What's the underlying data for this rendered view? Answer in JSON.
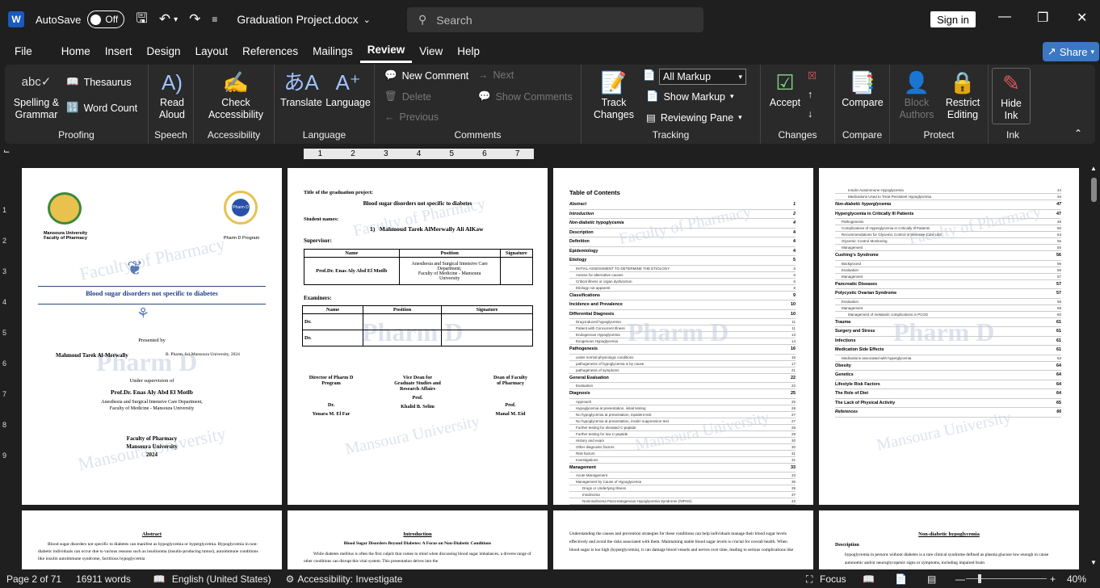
{
  "titlebar": {
    "logo": "W",
    "autosave_label": "AutoSave",
    "autosave_state": "Off",
    "document_name": "Graduation Project.docx",
    "search_placeholder": "Search",
    "signin_label": "Sign in"
  },
  "menu": {
    "items": [
      "File",
      "Home",
      "Insert",
      "Design",
      "Layout",
      "References",
      "Mailings",
      "Review",
      "View",
      "Help"
    ],
    "active": "Review",
    "share_label": "Share"
  },
  "ribbon": {
    "proofing": {
      "label": "Proofing",
      "spelling": "Spelling &",
      "spelling2": "Grammar",
      "thesaurus": "Thesaurus",
      "word_count": "Word Count"
    },
    "speech": {
      "label": "Speech",
      "read": "Read",
      "read2": "Aloud"
    },
    "accessibility": {
      "label": "Accessibility",
      "check": "Check",
      "check2": "Accessibility"
    },
    "language": {
      "label": "Language",
      "translate": "Translate",
      "language": "Language"
    },
    "comments": {
      "label": "Comments",
      "new": "New Comment",
      "delete": "Delete",
      "previous": "Previous",
      "next": "Next",
      "show": "Show Comments"
    },
    "tracking": {
      "label": "Tracking",
      "track": "Track",
      "track2": "Changes",
      "markup_select": "All Markup",
      "show_markup": "Show Markup",
      "reviewing_pane": "Reviewing Pane"
    },
    "changes": {
      "label": "Changes",
      "accept": "Accept"
    },
    "compare": {
      "label": "Compare",
      "compare": "Compare"
    },
    "protect": {
      "label": "Protect",
      "block": "Block",
      "block2": "Authors",
      "restrict": "Restrict",
      "restrict2": "Editing"
    },
    "ink": {
      "label": "Ink",
      "hide": "Hide",
      "hide2": "Ink"
    }
  },
  "ruler": {
    "ticks": [
      "1",
      "2",
      "3",
      "4",
      "5",
      "6",
      "7"
    ]
  },
  "vruler": {
    "ticks": [
      "1",
      "2",
      "3",
      "4",
      "5",
      "6",
      "7",
      "8",
      "9"
    ]
  },
  "page1": {
    "uni1": "Mansoura University",
    "uni2": "Faculty of Pharmacy",
    "program": "Pharm D Program",
    "badge": "Pharm D",
    "title": "Blood sugar disorders not specific to diabetes",
    "presented_by": "Presented by",
    "student": "Mahmoud Tarek Al-Merwally",
    "degree": "B. Pharm. Sci.Mansoura University, 2024",
    "supervision": "Under supervision of",
    "prof": "Prof.Dr. Enas Aly Abd El Motlb",
    "dept1": "Anesthesia and Surgical Intensive Care Department,",
    "dept2": "Faculty of Medicine - Mansoura University",
    "foot1": "Faculty of Pharmacy",
    "foot2": "Mansoura University",
    "foot3": "2024",
    "wm1": "Faculty of Pharmacy",
    "wm2": "Pharm D",
    "wm3": "Mansoura University"
  },
  "page2": {
    "title_label": "Title of the graduation project:",
    "title": "Blood sugar disorders not specific to diabetes",
    "student_names": "Student names:",
    "student": "Mahmoud Tarek AlMerwally Ali AlKaw",
    "student_num": "1)",
    "supervisor": "Supervisor:",
    "headers": [
      "Name",
      "Position",
      "Signature"
    ],
    "sup_name": "Prof.Dr. Enas Aly Abd El Motlb",
    "sup_pos1": "Anesthesia and Surgical Intensive Care",
    "sup_pos2": "Department,",
    "sup_pos3": "Faculty of Medicine - Mansoura",
    "sup_pos4": "University",
    "examiners": "Examiners:",
    "dr": "Dr.",
    "dir1": "Director of Pharm D",
    "dir2": "Program",
    "dir3": "Dr.",
    "dir4": "Youara M. El Far",
    "vice1": "Vice Dean for",
    "vice2": "Graduate Studies and",
    "vice3": "Research Affairs",
    "vice4": "Prof.",
    "vice5": "Khalid B. Selim",
    "dean1": "Dean of Faculty",
    "dean2": "of Pharmacy",
    "dean3": "Prof.",
    "dean4": "Manal M. Eid"
  },
  "page3": {
    "heading": "Table of Contents",
    "entries": [
      {
        "t": "Abstract",
        "p": "1",
        "c": "i"
      },
      {
        "t": "Introduction",
        "p": "2",
        "c": "i"
      },
      {
        "t": "Non-diabetic hypoglycemia",
        "p": "4",
        "c": "i"
      },
      {
        "t": "Description",
        "p": "4",
        "c": "h"
      },
      {
        "t": "Definition",
        "p": "4",
        "c": "h"
      },
      {
        "t": "Epidemiology",
        "p": "4",
        "c": "h"
      },
      {
        "t": "Etiology",
        "p": "5",
        "c": "h"
      },
      {
        "t": "INITIAL ASSESSMENT TO DETERMINE THE ETIOLOGY",
        "p": "6",
        "c": "s"
      },
      {
        "t": "Assess for alternative causes",
        "p": "6",
        "c": "s"
      },
      {
        "t": "Critical illness or organ dysfunction",
        "p": "6",
        "c": "s"
      },
      {
        "t": "Etiology not apparent",
        "p": "8",
        "c": "s"
      },
      {
        "t": "Classifications",
        "p": "9",
        "c": "h"
      },
      {
        "t": "Incidence and Prevalence",
        "p": "10",
        "c": "h"
      },
      {
        "t": "Differential Diagnosis",
        "p": "10",
        "c": "h"
      },
      {
        "t": "Drug-induced hypoglycemia",
        "p": "11",
        "c": "s"
      },
      {
        "t": "Patient with Concurrent Illness",
        "p": "11",
        "c": "s"
      },
      {
        "t": "Endogenous Hypoglycemia",
        "p": "13",
        "c": "s"
      },
      {
        "t": "Exogenous Hypoglycemia",
        "p": "14",
        "c": "s"
      },
      {
        "t": "Pathogenesis",
        "p": "16",
        "c": "h"
      },
      {
        "t": "under normal physiologic conditions",
        "p": "16",
        "c": "s"
      },
      {
        "t": "pathogenesis of hypoglycemia is by cause",
        "p": "17",
        "c": "s"
      },
      {
        "t": "pathogenesis of symptoms",
        "p": "21",
        "c": "s"
      },
      {
        "t": "General Evaluation",
        "p": "22",
        "c": "h"
      },
      {
        "t": "Evaluation",
        "p": "22",
        "c": "s"
      },
      {
        "t": "Diagnosis",
        "p": "25",
        "c": "h"
      },
      {
        "t": "Approach",
        "p": "25",
        "c": "s"
      },
      {
        "t": "Hypoglycemia at presentation, initial testing",
        "p": "26",
        "c": "s"
      },
      {
        "t": "No hypoglycemia at presentation, inpatient test",
        "p": "27",
        "c": "s"
      },
      {
        "t": "No hypoglycemia at presentation, insulin suppression test",
        "p": "27",
        "c": "s"
      },
      {
        "t": "Further testing for elevated C-peptide",
        "p": "28",
        "c": "s"
      },
      {
        "t": "Further testing for low C-peptide",
        "p": "29",
        "c": "s"
      },
      {
        "t": "History and exam",
        "p": "30",
        "c": "s"
      },
      {
        "t": "Other diagnostic factors",
        "p": "30",
        "c": "s"
      },
      {
        "t": "Risk factors",
        "p": "31",
        "c": "s"
      },
      {
        "t": "Investigations",
        "p": "31",
        "c": "s"
      },
      {
        "t": "Management",
        "p": "33",
        "c": "h"
      },
      {
        "t": "Acute Management",
        "p": "33",
        "c": "s"
      },
      {
        "t": "Management by Cause of Hypoglycemia",
        "p": "35",
        "c": "s"
      },
      {
        "t": "Drugs or Underlying Illness",
        "p": "35",
        "c": "ss"
      },
      {
        "t": "Insulinoma",
        "p": "37",
        "c": "ss"
      },
      {
        "t": "Noninsulinoma Pancreatogenous Hypoglycemia Syndrome (NIPHS)",
        "p": "42",
        "c": "ss"
      },
      {
        "t": "Post-gastric Bypass Hypoglycemia",
        "p": "43",
        "c": "ss"
      }
    ]
  },
  "page4": {
    "entries": [
      {
        "t": "Insulin Autoimmune Hypoglycemia",
        "p": "44",
        "c": "ss"
      },
      {
        "t": "Medications Used to Treat Persistent Hypoglycemia",
        "p": "46",
        "c": "ss"
      },
      {
        "t": "Non-diabetic hyperglycemia",
        "p": "47",
        "c": "i"
      },
      {
        "t": "Hyperglycemia in Critically Ill Patients",
        "p": "47",
        "c": "h"
      },
      {
        "t": "Pathogenesis",
        "p": "48",
        "c": "s"
      },
      {
        "t": "Complications of Hyperglycemia in Critically Ill Patients",
        "p": "50",
        "c": "s"
      },
      {
        "t": "Recommendations for Glycemic Control in Intensive Care Unit",
        "p": "53",
        "c": "s"
      },
      {
        "t": "Glycemic Control Monitoring",
        "p": "55",
        "c": "s"
      },
      {
        "t": "Management",
        "p": "55",
        "c": "s"
      },
      {
        "t": "Cushing's Syndrome",
        "p": "56",
        "c": "h"
      },
      {
        "t": "Background",
        "p": "56",
        "c": "s"
      },
      {
        "t": "Evaluation",
        "p": "56",
        "c": "s"
      },
      {
        "t": "Management",
        "p": "57",
        "c": "s"
      },
      {
        "t": "Pancreatic Diseases",
        "p": "57",
        "c": "h"
      },
      {
        "t": "Polycystic Ovarian Syndrome",
        "p": "57",
        "c": "h"
      },
      {
        "t": "Evaluation",
        "p": "58",
        "c": "s"
      },
      {
        "t": "Management",
        "p": "59",
        "c": "s"
      },
      {
        "t": "Management of metabolic complications in PCOS",
        "p": "60",
        "c": "ss"
      },
      {
        "t": "Trauma",
        "p": "61",
        "c": "h"
      },
      {
        "t": "Surgery and Stress",
        "p": "61",
        "c": "h"
      },
      {
        "t": "Infections",
        "p": "61",
        "c": "h"
      },
      {
        "t": "Medication Side Effects",
        "p": "61",
        "c": "h"
      },
      {
        "t": "Medications associated with hyperglycemia",
        "p": "63",
        "c": "s"
      },
      {
        "t": "Obesity",
        "p": "64",
        "c": "h"
      },
      {
        "t": "Genetics",
        "p": "64",
        "c": "h"
      },
      {
        "t": "Lifestyle Risk Factors",
        "p": "64",
        "c": "h"
      },
      {
        "t": "The Role of Diet",
        "p": "64",
        "c": "h"
      },
      {
        "t": "The Lack of Physical Activity",
        "p": "65",
        "c": "h"
      },
      {
        "t": "References",
        "p": "66",
        "c": "i"
      }
    ]
  },
  "row2": {
    "abstract_title": "Abstract",
    "abstract_text": "Blood sugar disorders not specific to diabetes can manifest as hypoglycemia or hyperglycemia. Hypoglycemia in non-diabetic individuals can occur due to various reasons such as insulinoma (insulin-producing tumor), autoimmune conditions like insulin autoimmune syndrome, factitious hypoglycemia",
    "intro_title": "Introduction",
    "intro_sub": "Blood Sugar Disorders Beyond Diabetes: A Focus on Non-Diabetic Conditions",
    "intro_text": "While diabetes mellitus is often the first culprit that comes to mind when discussing blood sugar imbalances, a diverse range of other conditions can disrupt this vital system. This presentation delves into the",
    "p3_text": "Understanding the causes and prevention strategies for these conditions can help individuals manage their blood sugar levels effectively and avoid the risks associated with them. Maintaining stable blood sugar levels is crucial for overall health. When blood sugar is too high (hyperglycemia), it can damage blood vessels and nerves over time, leading to serious complications like",
    "p4_title": "Non-diabetic hypoglycemia",
    "p4_desc": "Description",
    "p4_text": "hypoglycemia in persons without diabetes is a rare clinical syndrome defined as plasma glucose low enough to cause autonomic and/or neuroglycopenic signs or symptoms, including impaired brain"
  },
  "status": {
    "page": "Page 2 of 71",
    "words": "16911 words",
    "language": "English (United States)",
    "accessibility": "Accessibility: Investigate",
    "focus": "Focus",
    "zoom": "40%"
  },
  "colors": {
    "accent": "#185abd",
    "share": "#3b78c4",
    "title_blue": "#1f3d8a"
  }
}
